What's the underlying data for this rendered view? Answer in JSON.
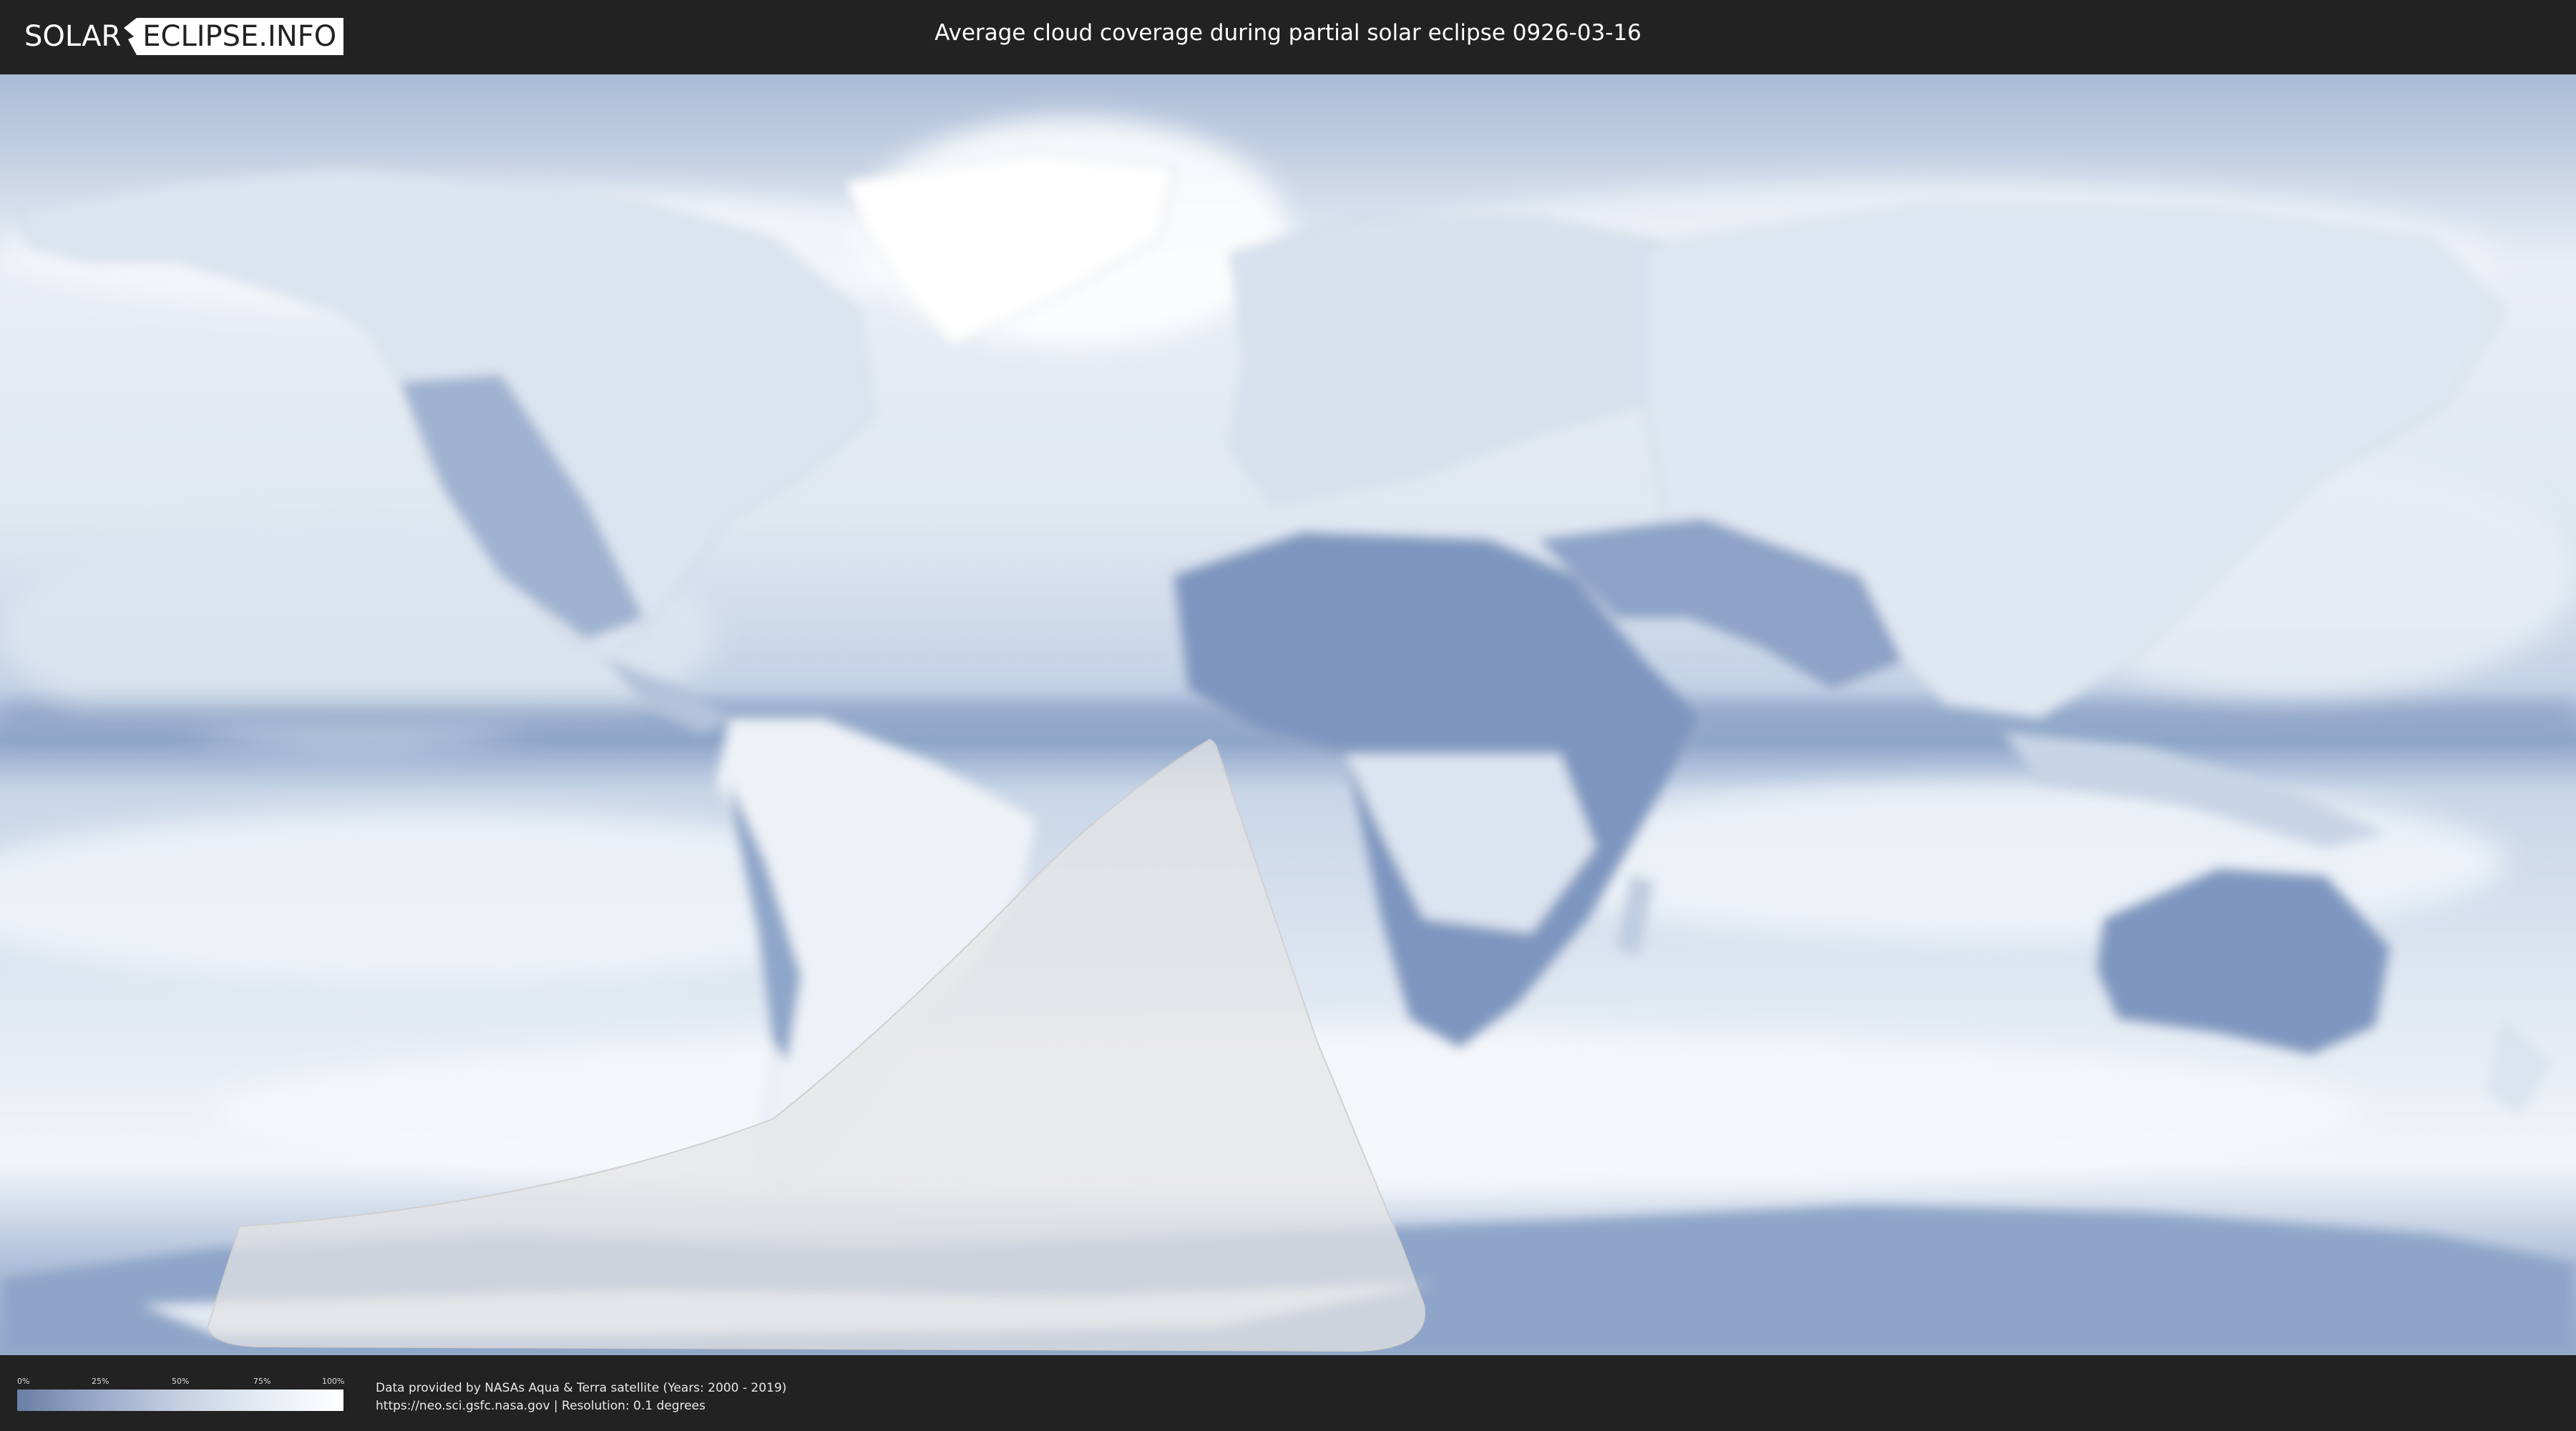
{
  "header": {
    "logo_text_left": "SOLAR",
    "logo_text_box": "ECLIPSE.INFO",
    "title": "Average cloud coverage during partial solar eclipse 0926-03-16"
  },
  "map": {
    "description_colors": {
      "ocean_clear": "#6d87b3",
      "cloud_white": "#f3f6fa",
      "land_desert": "#5f79a8",
      "eclipse_overlay": "#e0e0e0"
    }
  },
  "legend": {
    "ticks": [
      "0%",
      "25%",
      "50%",
      "75%",
      "100%"
    ],
    "gradient": [
      "#6a7fa6",
      "#9aaac8",
      "#c5d0e2",
      "#e6ecf4",
      "#ffffff"
    ]
  },
  "footer": {
    "credit_line1": "Data provided by NASAs Aqua & Terra satellite (Years: 2000 - 2019)",
    "credit_line2": "https://neo.sci.gsfc.nasa.gov | Resolution: 0.1 degrees"
  }
}
